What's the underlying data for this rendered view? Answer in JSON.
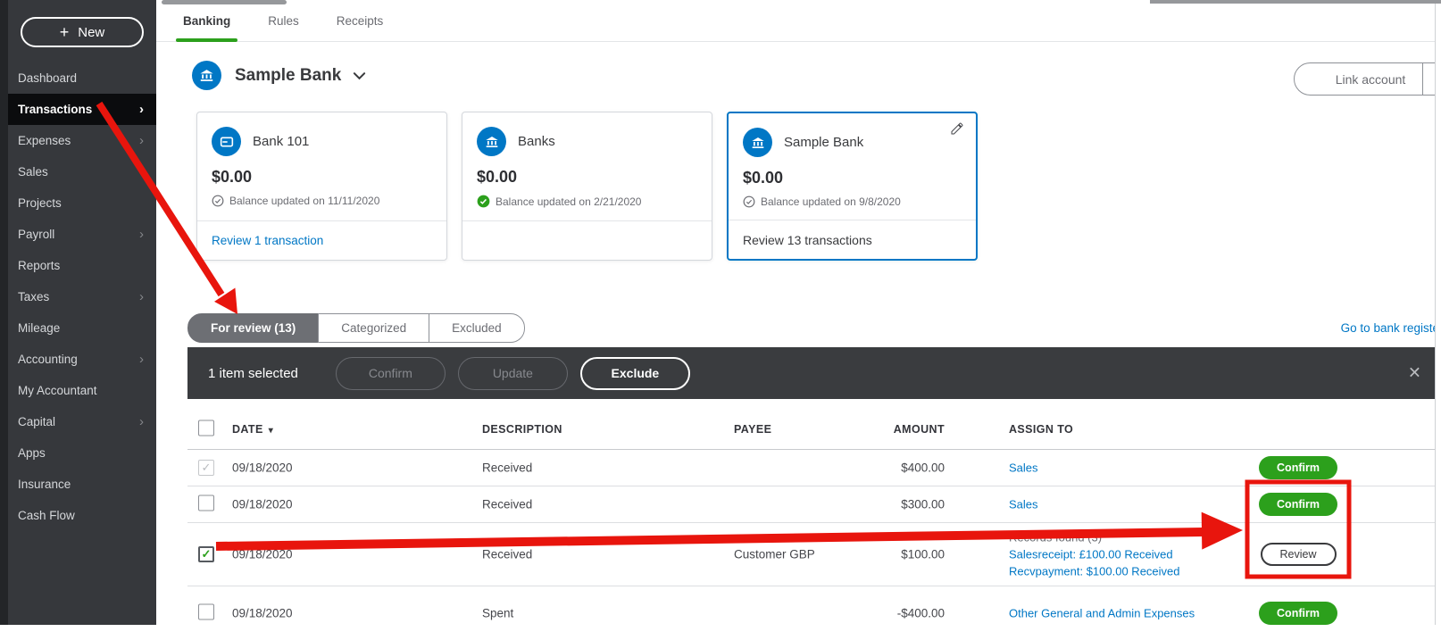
{
  "colors": {
    "green": "#2ca01c",
    "blue": "#0077c5",
    "red": "#e8150d",
    "darkbar": "#3a3c3f"
  },
  "icons": {
    "plus": "+",
    "chevron_right": "›",
    "check": "✓",
    "close": "✕",
    "triangle_down": "▾"
  },
  "sidebar": {
    "new_label": "New",
    "items": [
      {
        "label": "Dashboard",
        "chevron": false,
        "active": false
      },
      {
        "label": "Transactions",
        "chevron": true,
        "active": true
      },
      {
        "label": "Expenses",
        "chevron": true,
        "active": false
      },
      {
        "label": "Sales",
        "chevron": false,
        "active": false
      },
      {
        "label": "Projects",
        "chevron": false,
        "active": false
      },
      {
        "label": "Payroll",
        "chevron": true,
        "active": false
      },
      {
        "label": "Reports",
        "chevron": false,
        "active": false
      },
      {
        "label": "Taxes",
        "chevron": true,
        "active": false
      },
      {
        "label": "Mileage",
        "chevron": false,
        "active": false
      },
      {
        "label": "Accounting",
        "chevron": true,
        "active": false
      },
      {
        "label": "My Accountant",
        "chevron": false,
        "active": false
      },
      {
        "label": "Capital",
        "chevron": true,
        "active": false
      },
      {
        "label": "Apps",
        "chevron": false,
        "active": false
      },
      {
        "label": "Insurance",
        "chevron": false,
        "active": false
      },
      {
        "label": "Cash Flow",
        "chevron": false,
        "active": false
      }
    ]
  },
  "topnav": {
    "tabs": [
      {
        "label": "Banking",
        "active": true
      },
      {
        "label": "Rules",
        "active": false
      },
      {
        "label": "Receipts",
        "active": false
      }
    ]
  },
  "bank_header": {
    "title": "Sample Bank",
    "link_account_label": "Link account"
  },
  "cards": [
    {
      "name": "Bank 101",
      "icon": "card",
      "balance": "$0.00",
      "updated": "Balance updated on 11/11/2020",
      "check_style": "outline",
      "footer_text": "Review 1 transaction",
      "footer_style": "link",
      "selected": false
    },
    {
      "name": "Banks",
      "icon": "bank",
      "balance": "$0.00",
      "updated": "Balance updated on 2/21/2020",
      "check_style": "green",
      "footer_text": "",
      "footer_style": "none",
      "selected": false
    },
    {
      "name": "Sample Bank",
      "icon": "bank",
      "balance": "$0.00",
      "updated": "Balance updated on 9/8/2020",
      "check_style": "outline",
      "footer_text": "Review 13 transactions",
      "footer_style": "plain",
      "selected": true
    }
  ],
  "filter": {
    "tabs": [
      {
        "label": "For review (13)",
        "active": true
      },
      {
        "label": "Categorized",
        "active": false
      },
      {
        "label": "Excluded",
        "active": false
      }
    ],
    "register_link": "Go to bank registe"
  },
  "action_bar": {
    "selected_text": "1 item selected",
    "buttons": [
      {
        "label": "Confirm",
        "enabled": false
      },
      {
        "label": "Update",
        "enabled": false
      },
      {
        "label": "Exclude",
        "enabled": true
      }
    ]
  },
  "table": {
    "headers": {
      "date": "DATE",
      "description": "DESCRIPTION",
      "payee": "PAYEE",
      "amount": "AMOUNT",
      "assign": "ASSIGN TO"
    },
    "rows": [
      {
        "checkbox": "disabled-checked",
        "date": "09/18/2020",
        "description": "Received",
        "payee": "",
        "amount": "$400.00",
        "assign": [
          {
            "text": "Sales",
            "type": "link"
          }
        ],
        "action": "Confirm",
        "action_style": "green"
      },
      {
        "checkbox": "unchecked",
        "date": "09/18/2020",
        "description": "Received",
        "payee": "",
        "amount": "$300.00",
        "assign": [
          {
            "text": "Sales",
            "type": "link"
          }
        ],
        "action": "Confirm",
        "action_style": "green"
      },
      {
        "checkbox": "checked",
        "date": "09/18/2020",
        "description": "Received",
        "payee": "Customer GBP",
        "amount": "$100.00",
        "assign": [
          {
            "text": "Records found (3)",
            "type": "plain"
          },
          {
            "text": "Salesreceipt: £100.00 Received",
            "type": "link"
          },
          {
            "text": "Recvpayment: $100.00 Received",
            "type": "link"
          }
        ],
        "action": "Review",
        "action_style": "outline"
      },
      {
        "checkbox": "unchecked",
        "date": "09/18/2020",
        "description": "Spent",
        "payee": "",
        "amount": "-$400.00",
        "assign": [
          {
            "text": "Other General and Admin Expenses",
            "type": "link"
          }
        ],
        "action": "Confirm",
        "action_style": "green"
      }
    ]
  }
}
